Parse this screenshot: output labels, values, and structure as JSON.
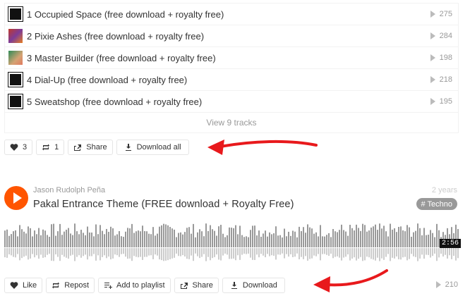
{
  "tracklist": {
    "tracks": [
      {
        "title": "1 Occupied Space (free download + royalty free)",
        "plays": "275"
      },
      {
        "title": "2 Pixie Ashes (free download + royalty free)",
        "plays": "284"
      },
      {
        "title": "3 Master Builder (free download + royalty free)",
        "plays": "198"
      },
      {
        "title": "4 Dial-Up (free download + royalty free)",
        "plays": "218"
      },
      {
        "title": "5 Sweatshop (free download + royalty free)",
        "plays": "195"
      }
    ],
    "view_more_label": "View 9 tracks"
  },
  "playlist_actions": {
    "like_count": "3",
    "repost_count": "1",
    "share_label": "Share",
    "download_all_label": "Download all"
  },
  "player": {
    "artist": "Jason Rudolph Peña",
    "time_ago": "2 years",
    "title": "Pakal Entrance Theme (FREE download + Royalty Free)",
    "genre_tag": "# Techno",
    "duration": "2:56",
    "plays": "210"
  },
  "track_actions": {
    "like_label": "Like",
    "repost_label": "Repost",
    "add_to_playlist_label": "Add to playlist",
    "share_label": "Share",
    "download_label": "Download"
  },
  "colors": {
    "accent": "#ff5500",
    "arrow": "#e8191c",
    "waveform_top": "#999999",
    "waveform_bottom": "#cccccc"
  }
}
